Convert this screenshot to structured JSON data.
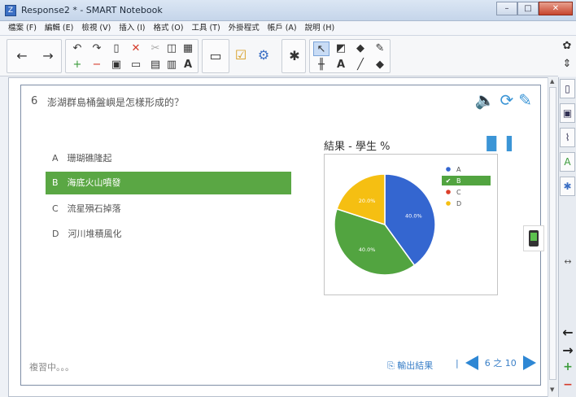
{
  "window": {
    "title": "Response2 * - SMART Notebook",
    "app_icon": "notebook-icon",
    "minimize": "–",
    "maximize": "□",
    "close": "✕"
  },
  "menu": [
    "檔案 (F)",
    "編輯 (E)",
    "檢視 (V)",
    "插入 (I)",
    "格式 (O)",
    "工具 (T)",
    "外掛程式",
    "帳戶 (A)",
    "說明 (H)"
  ],
  "toolbar": {
    "back": "←",
    "forward": "→",
    "undo": "↶",
    "redo": "↷",
    "paste": "▯",
    "delete": "✕",
    "cut": "✂",
    "screen": "◫",
    "table": "▦",
    "add_page": "+",
    "remove_page": "−",
    "save": "▣",
    "present": "▭",
    "doc": "▤",
    "clip": "▥",
    "spell": "A",
    "display": "▭",
    "check": "☑",
    "tool": "⚙",
    "addon": "✱",
    "select": "↖",
    "shape_draw": "◩",
    "fill": "◆",
    "magic": "✎",
    "measure": "╫",
    "text": "A",
    "line": "╱",
    "eraser": "◆",
    "settings": "✿",
    "updown": "⇕"
  },
  "question": {
    "number": "6",
    "text": "澎湖群島桶盤嶼是怎樣形成的？"
  },
  "options": [
    {
      "letter": "A",
      "text": "珊瑚礁隆起",
      "selected": false
    },
    {
      "letter": "B",
      "text": "海底火山噴發",
      "selected": true
    },
    {
      "letter": "C",
      "text": "流星殞石掉落",
      "selected": false
    },
    {
      "letter": "D",
      "text": "河川堆積風化",
      "selected": false
    }
  ],
  "option_rows": [
    "A　珊瑚礁隆起",
    "B　海底火山噴發",
    "C　流星殞石掉落",
    "D　河川堆積風化"
  ],
  "chart_data": {
    "type": "pie",
    "title": "結果 - 學生 %",
    "categories": [
      "A",
      "B",
      "C",
      "D"
    ],
    "values": [
      40.0,
      40.0,
      0.0,
      20.0
    ],
    "slice_labels": [
      "40.0%",
      "40.0%",
      "",
      "20.0%"
    ],
    "colors": [
      "#3466d0",
      "#52a440",
      "#dc3f2a",
      "#f5bf12"
    ],
    "legend_placement": "right",
    "legend_selected": "B"
  },
  "footer": {
    "status": "複習中。。。",
    "export": "輸出結果",
    "separator": "|",
    "page": "6 之 10"
  },
  "sidebar": [
    "page-sorter-icon",
    "gallery-icon",
    "attachment-icon",
    "properties-icon",
    "addons-icon"
  ],
  "sidebar_tools": [
    "←",
    "→",
    "+",
    "−"
  ],
  "resize": "↔"
}
